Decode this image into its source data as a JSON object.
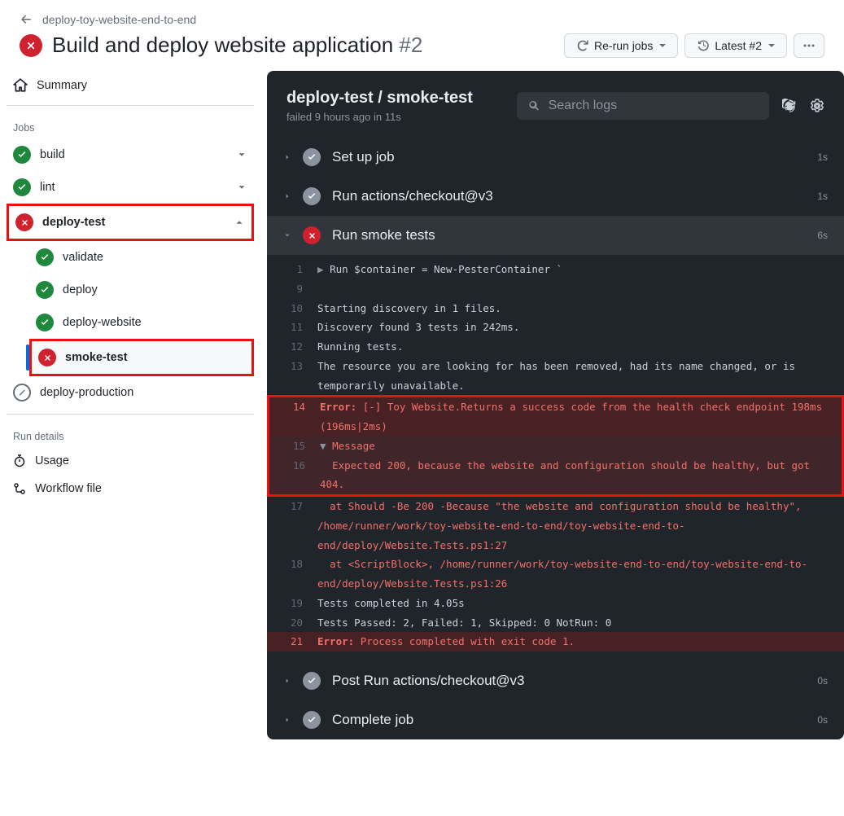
{
  "breadcrumb": "deploy-toy-website-end-to-end",
  "runTitle": "Build and deploy website application",
  "runNumber": "#2",
  "buttons": {
    "rerun": "Re-run jobs",
    "latest": "Latest #2"
  },
  "sidebar": {
    "summary": "Summary",
    "jobsHeader": "Jobs",
    "jobs": [
      {
        "name": "build",
        "status": "ok",
        "expandable": true
      },
      {
        "name": "lint",
        "status": "ok",
        "expandable": true
      },
      {
        "name": "deploy-test",
        "status": "fail",
        "expandable": true,
        "children": [
          {
            "name": "validate",
            "status": "ok"
          },
          {
            "name": "deploy",
            "status": "ok"
          },
          {
            "name": "deploy-website",
            "status": "ok"
          },
          {
            "name": "smoke-test",
            "status": "fail"
          }
        ]
      },
      {
        "name": "deploy-production",
        "status": "skip"
      }
    ],
    "runDetails": "Run details",
    "usage": "Usage",
    "workflow": "Workflow file"
  },
  "panel": {
    "title": "deploy-test / smoke-test",
    "subtitle": "failed 9 hours ago in 11s",
    "searchPlaceholder": "Search logs",
    "steps": [
      {
        "name": "Set up job",
        "status": "done",
        "time": "1s",
        "open": false
      },
      {
        "name": "Run actions/checkout@v3",
        "status": "done",
        "time": "1s",
        "open": false
      },
      {
        "name": "Run smoke tests",
        "status": "fail",
        "time": "6s",
        "open": true
      },
      {
        "name": "Post Run actions/checkout@v3",
        "status": "done",
        "time": "0s",
        "open": false
      },
      {
        "name": "Complete job",
        "status": "done",
        "time": "0s",
        "open": false
      }
    ],
    "log": {
      "l1_caret": "▶ ",
      "l1": "Run $container = New-PesterContainer `",
      "l10": "Starting discovery in 1 files.",
      "l11": "Discovery found 3 tests in 242ms.",
      "l12": "Running tests.",
      "l13": "The resource you are looking for has been removed, had its name changed, or is temporarily unavailable.",
      "l14_err": "Error: ",
      "l14": "[-] Toy Website.Returns a success code from the health check endpoint 198ms (196ms|2ms)",
      "l15_caret": "▼ ",
      "l15": "Message",
      "l16": "  Expected 200, because the website and configuration should be healthy, but got 404.",
      "l17": "  at Should -Be 200 -Because \"the website and configuration should be healthy\", /home/runner/work/toy-website-end-to-end/toy-website-end-to-end/deploy/Website.Tests.ps1:27",
      "l18": "  at <ScriptBlock>, /home/runner/work/toy-website-end-to-end/toy-website-end-to-end/deploy/Website.Tests.ps1:26",
      "l19": "Tests completed in 4.05s",
      "l20": "Tests Passed: 2, Failed: 1, Skipped: 0 NotRun: 0",
      "l21_err": "Error: ",
      "l21": "Process completed with exit code 1."
    }
  }
}
